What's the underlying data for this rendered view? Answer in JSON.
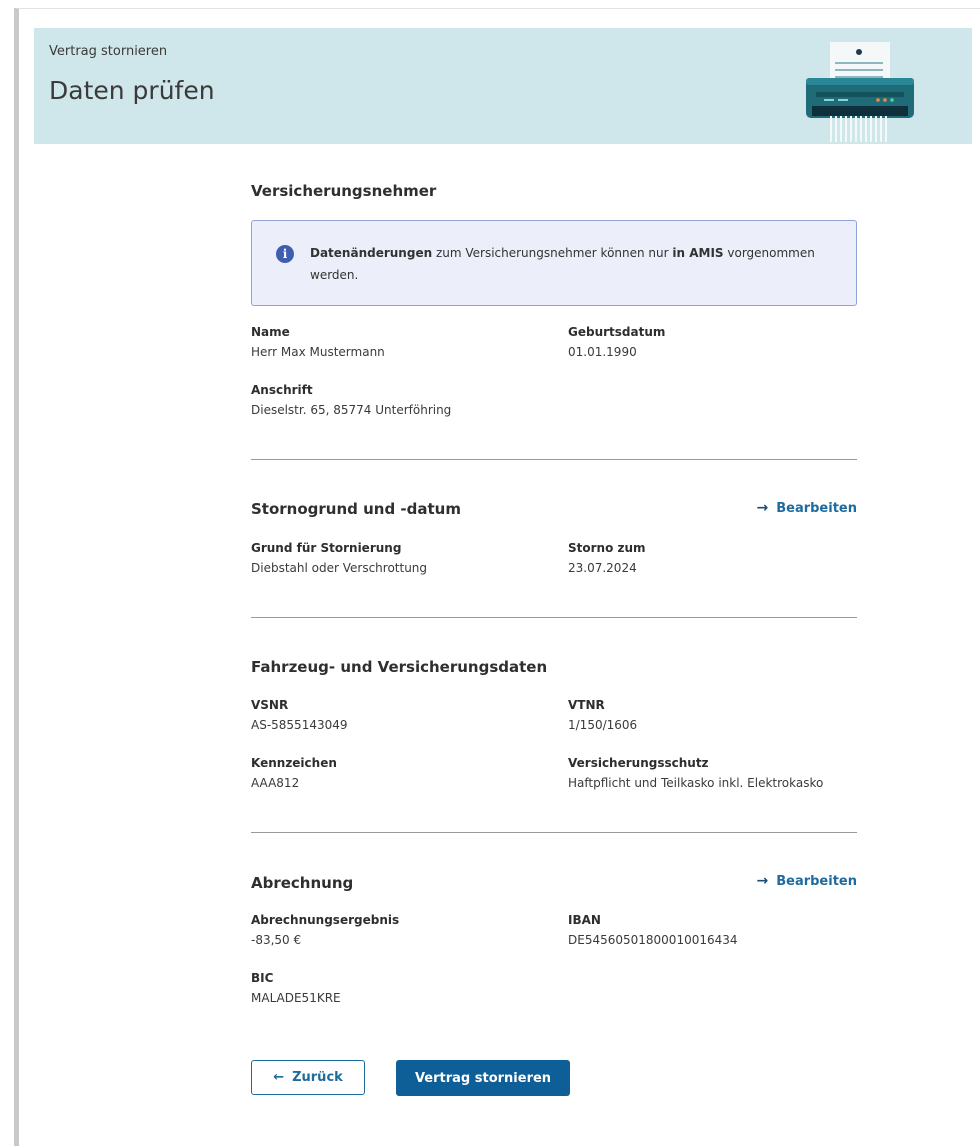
{
  "header": {
    "breadcrumb": "Vertrag stornieren",
    "title": "Daten prüfen",
    "illustration_icon": "shredder-icon"
  },
  "policyholder": {
    "title": "Versicherungsnehmer",
    "notice": {
      "bold1": "Datenänderungen",
      "text1": " zum Versicherungsnehmer können nur ",
      "bold2": "in AMIS",
      "text2": " vorgenommen werden."
    },
    "name_label": "Name",
    "name_value": "Herr Max Mustermann",
    "birth_label": "Geburtsdatum",
    "birth_value": "01.01.1990",
    "address_label": "Anschrift",
    "address_value": "Dieselstr. 65, 85774 Unterföhring"
  },
  "cancellation": {
    "title": "Stornogrund und -datum",
    "edit_label": "Bearbeiten",
    "reason_label": "Grund für Stornierung",
    "reason_value": "Diebstahl oder Verschrottung",
    "date_label": "Storno zum",
    "date_value": "23.07.2024"
  },
  "vehicle": {
    "title": "Fahrzeug- und Versicherungsdaten",
    "vsnr_label": "VSNR",
    "vsnr_value": "AS-5855143049",
    "vtnr_label": "VTNR",
    "vtnr_value": "1/150/1606",
    "plate_label": "Kennzeichen",
    "plate_value": "AAA812",
    "coverage_label": "Versicherungsschutz",
    "coverage_value": "Haftpflicht und Teilkasko inkl. Elektrokasko"
  },
  "billing": {
    "title": "Abrechnung",
    "edit_label": "Bearbeiten",
    "result_label": "Abrechnungsergebnis",
    "result_value": "-83,50 €",
    "iban_label": "IBAN",
    "iban_value": "DE54560501800010016434",
    "bic_label": "BIC",
    "bic_value": "MALADE51KRE"
  },
  "actions": {
    "back_label": "Zurück",
    "submit_label": "Vertrag stornieren"
  },
  "colors": {
    "header_bg": "#cfe6ea",
    "primary": "#0e5f97",
    "link": "#1f6b9e",
    "notice_bg": "#eceff9",
    "notice_border": "#8fa3d6"
  }
}
